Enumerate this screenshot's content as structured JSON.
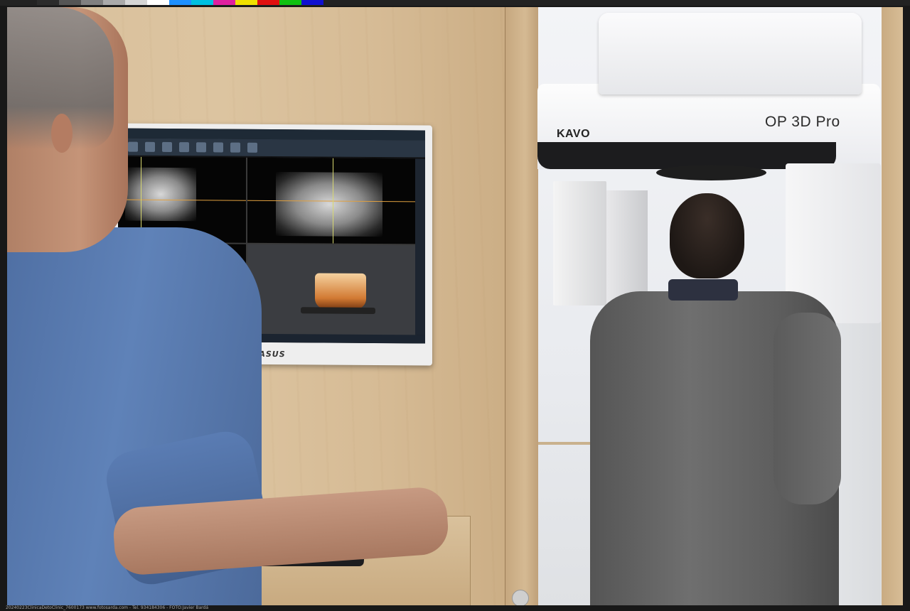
{
  "photo": {
    "monitor_brand": "ASUS",
    "machine_brand": "KAVO",
    "machine_model": "OP 3D Pro"
  },
  "caption": "20240223ClinicaDetoClinic_7600173     www.fotosarda.com - Tel. 934184306 - FOTO:Javier Bardá",
  "colors": {
    "swatches": [
      "#2b2b2b",
      "#555555",
      "#808080",
      "#aaaaaa",
      "#d5d5d5",
      "#ffffff",
      "#1e90ff",
      "#00c0e0",
      "#e020a0",
      "#f0e000",
      "#e01010",
      "#10c010",
      "#1010d0"
    ],
    "wall_wood": "#d9c09c",
    "doctor_shirt": "#5f82b8",
    "patient_sweater": "#666666"
  }
}
